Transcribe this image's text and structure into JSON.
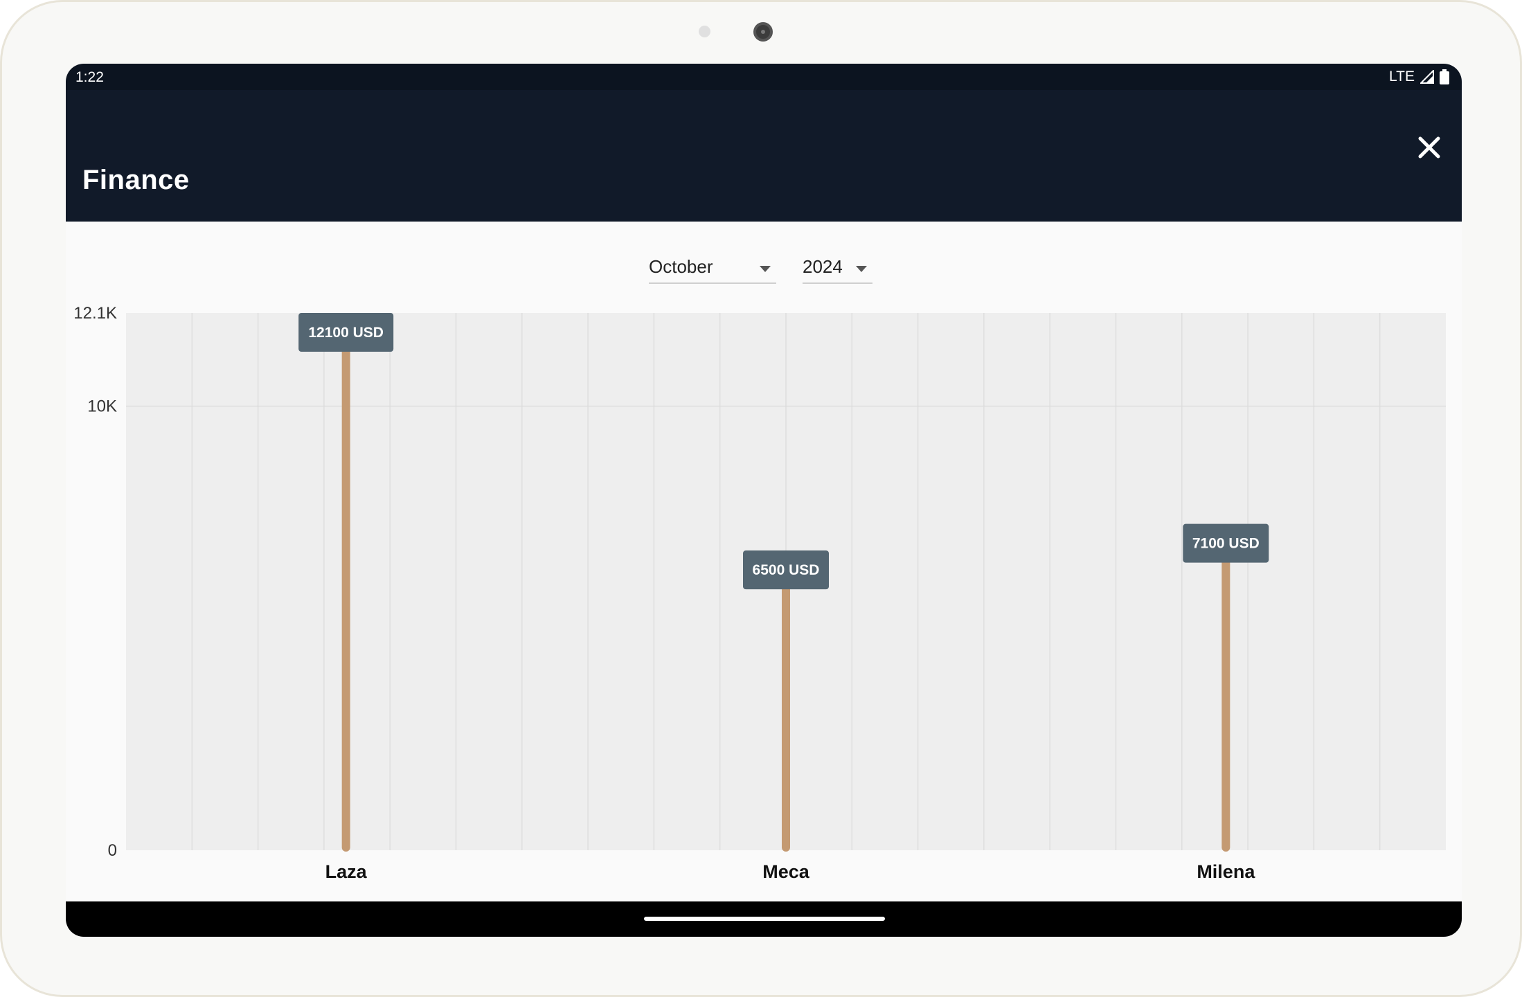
{
  "status_bar": {
    "time": "1:22",
    "network": "LTE",
    "icons": [
      "signal-icon",
      "battery-icon"
    ]
  },
  "app_bar": {
    "title": "Finance",
    "close_icon": "close-icon"
  },
  "filters": {
    "month": {
      "selected": "October"
    },
    "year": {
      "selected": "2024"
    }
  },
  "colors": {
    "header": "#111a29",
    "bar": "#c49a72",
    "label_bg": "#546672",
    "plot_bg": "#eeeeee"
  },
  "chart_data": {
    "type": "bar",
    "categories": [
      "Laza",
      "Meca",
      "Milena"
    ],
    "values": [
      12100,
      6500,
      7100
    ],
    "value_labels": [
      "12100 USD",
      "6500 USD",
      "7100 USD"
    ],
    "y_ticks": [
      0,
      10000,
      12100
    ],
    "y_tick_labels": [
      "0",
      "10K",
      "12.1K"
    ],
    "ylim": [
      0,
      12100
    ],
    "grid": true,
    "title": "",
    "xlabel": "",
    "ylabel": ""
  }
}
